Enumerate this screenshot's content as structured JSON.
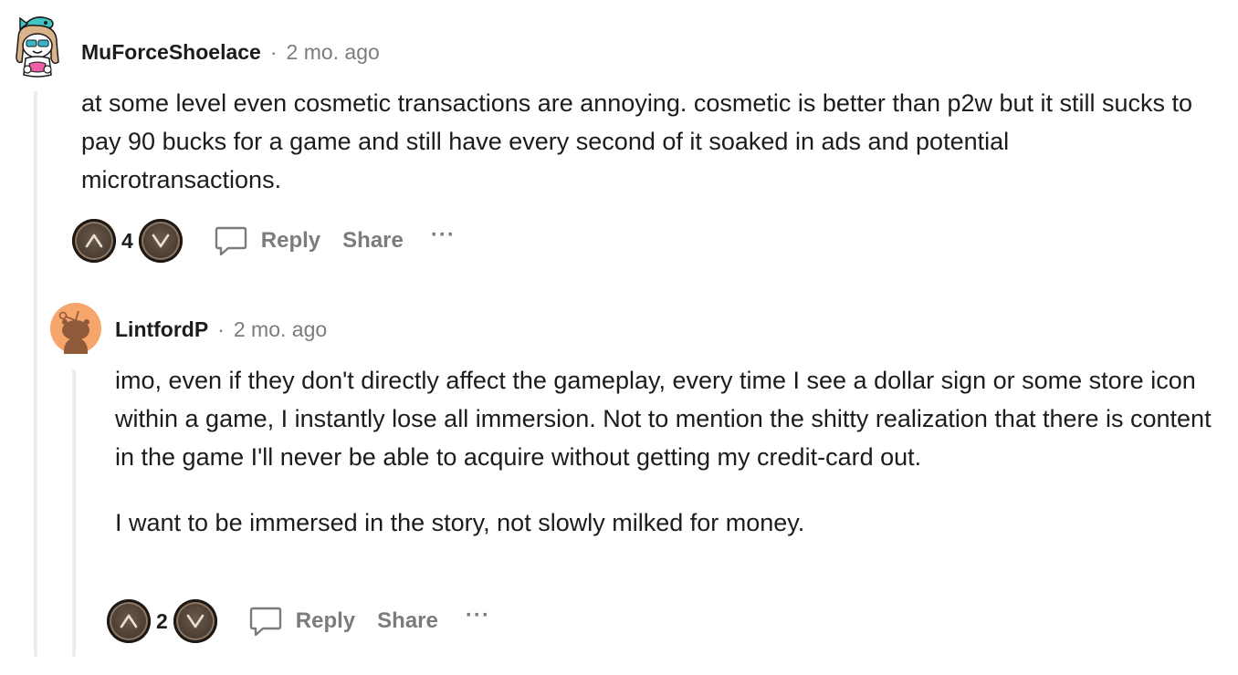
{
  "comments": [
    {
      "username": "MuForceShoelace",
      "separator": "·",
      "time": "2 mo. ago",
      "body": [
        "at some level even cosmetic transactions are annoying. cosmetic is better than p2w but it still sucks to pay 90 bucks for a game and still have every second of it soaked in ads and potential microtransactions."
      ],
      "votes": "4",
      "reply_label": "Reply",
      "share_label": "Share",
      "more_label": "···"
    },
    {
      "username": "LintfordP",
      "separator": "·",
      "time": "2 mo. ago",
      "body": [
        "imo, even if they don't directly affect the gameplay, every time I see a dollar sign or some store icon within a game, I instantly lose all immersion. Not to mention the shitty realization that there is content in the game I'll never be able to acquire without getting my credit-card out.",
        "I want to be immersed in the story, not slowly milked for money."
      ],
      "votes": "2",
      "reply_label": "Reply",
      "share_label": "Share",
      "more_label": "···"
    }
  ],
  "icons": {
    "upvote": "upvote-icon",
    "downvote": "downvote-icon",
    "reply": "comment-bubble-icon"
  },
  "colors": {
    "meta_gray": "#7c7c7c",
    "thread_line": "#ececec",
    "avatar2_bg": "#f6a56b"
  }
}
